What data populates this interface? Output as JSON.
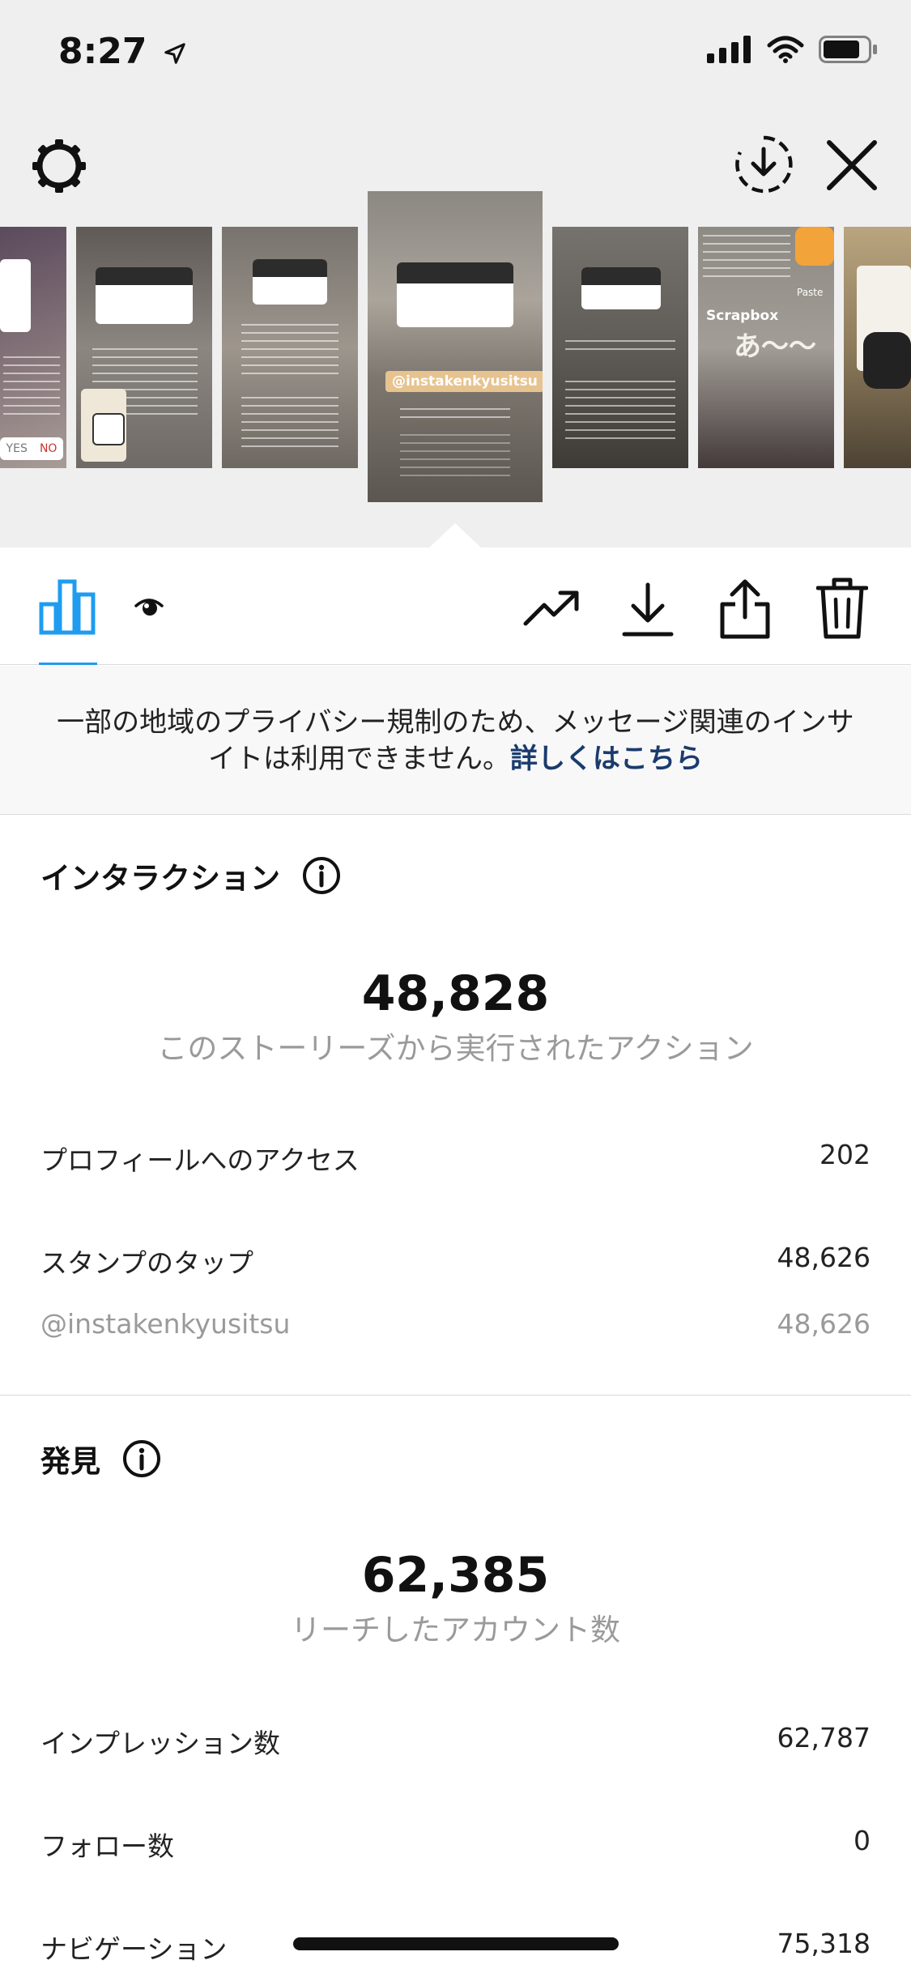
{
  "status_bar": {
    "time": "8:27",
    "icons": [
      "location-arrow-icon",
      "cellular-signal-icon",
      "wifi-icon",
      "battery-icon"
    ]
  },
  "header": {
    "icons": [
      "gear-icon",
      "download-circle-icon",
      "close-icon"
    ]
  },
  "thumbnails": {
    "selected_tag": "@instakenkyusitsu",
    "scrapbox_label": "Scrapbox",
    "paste_label": "Paste",
    "a_label": "あ〜〜",
    "yes_label": "YES",
    "no_label": "NO"
  },
  "toolbar": {
    "icons": [
      "bar-chart-icon",
      "eye-icon",
      "trending-up-icon",
      "download-icon",
      "share-icon",
      "trash-icon"
    ],
    "accent": "#1f9cf0"
  },
  "notice": {
    "text": "一部の地域のプライバシー規制のため、メッセージ関連のインサイトは利用できません。",
    "link": "詳しくはこちら"
  },
  "interactions": {
    "title": "インタラクション",
    "total": "48,828",
    "total_label": "このストーリーズから実行されたアクション",
    "rows": [
      {
        "label": "プロフィールへのアクセス",
        "value": "202"
      },
      {
        "label": "スタンプのタップ",
        "value": "48,626"
      },
      {
        "label": "@instakenkyusitsu",
        "value": "48,626"
      }
    ]
  },
  "discovery": {
    "title": "発見",
    "total": "62,385",
    "total_label": "リーチしたアカウント数",
    "rows": [
      {
        "label": "インプレッション数",
        "value": "62,787"
      },
      {
        "label": "フォロー数",
        "value": "0"
      },
      {
        "label": "ナビゲーション",
        "value": "75,318"
      }
    ]
  }
}
